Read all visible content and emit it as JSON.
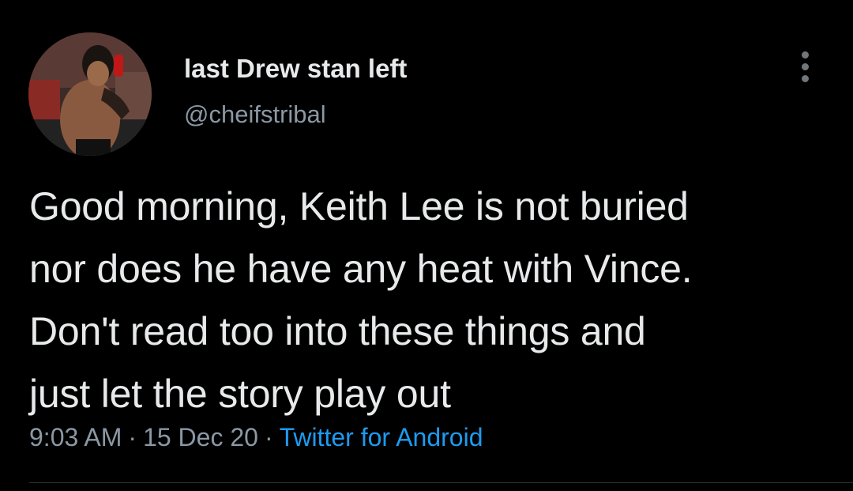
{
  "author": {
    "display_name": "last Drew stan left",
    "handle": "@cheifstribal",
    "avatar_icon": "wrestler-profile-photo"
  },
  "menu": {
    "icon": "more-horizontal-icon"
  },
  "tweet": {
    "lines": [
      "Good morning, Keith Lee is not buried",
      "nor does he have any heat with Vince.",
      "Don't read too into these things and",
      "just let the story play out"
    ]
  },
  "meta": {
    "time": "9:03 AM",
    "separator": "·",
    "date": "15 Dec 20",
    "source": "Twitter for Android"
  },
  "colors": {
    "background": "#000000",
    "primary_text": "#e7e9ea",
    "secondary_text": "#8b98a5",
    "link": "#1d9bf0"
  }
}
